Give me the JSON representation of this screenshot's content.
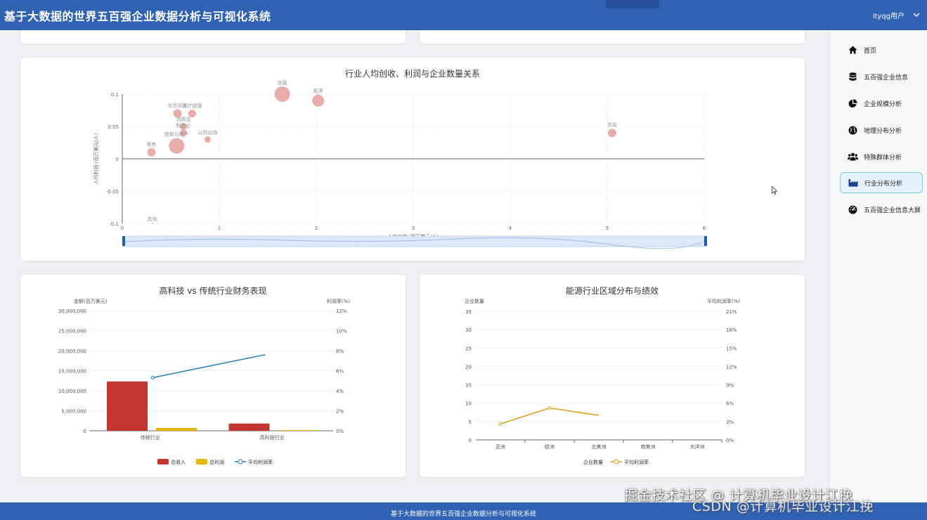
{
  "header": {
    "title": "基于大数据的世界五百强企业数据分析与可视化系统",
    "user": "ityqg用户"
  },
  "sidebar": {
    "items": [
      {
        "label": "首页",
        "icon": "home-icon"
      },
      {
        "label": "五百强企业信息",
        "icon": "database-icon"
      },
      {
        "label": "企业规模分析",
        "icon": "pie-chart-icon"
      },
      {
        "label": "地理分布分析",
        "icon": "globe-icon"
      },
      {
        "label": "特殊群体分析",
        "icon": "users-icon"
      },
      {
        "label": "行业分布分析",
        "icon": "industry-icon",
        "active": true
      },
      {
        "label": "五百强企业信息大屏",
        "icon": "dashboard-icon"
      }
    ]
  },
  "chart_data": [
    {
      "type": "scatter",
      "title": "行业人均创收、利润与企业数量关系",
      "xlabel": "人均创收 (百万美元/人)",
      "ylabel": "人均利润 (百万美元/人)",
      "xlim": [
        0,
        6
      ],
      "ylim": [
        -0.1,
        0.1
      ],
      "xticks": [
        "0",
        "1",
        "2",
        "3",
        "4",
        "5",
        "6"
      ],
      "yticks": [
        "0.1",
        "0.05",
        "0",
        "-0.05",
        "-0.1"
      ],
      "points": [
        {
          "label": "金融",
          "x": 1.65,
          "y": 0.1,
          "size": 11
        },
        {
          "label": "能源",
          "x": 2.02,
          "y": 0.09,
          "size": 8.5
        },
        {
          "label": "信息技术",
          "x": 0.57,
          "y": 0.07,
          "size": 6
        },
        {
          "label": "医疗健康",
          "x": 0.72,
          "y": 0.07,
          "size": 5.5
        },
        {
          "label": "消费品",
          "x": 0.63,
          "y": 0.05,
          "size": 5
        },
        {
          "label": "制造业",
          "x": 0.63,
          "y": 0.04,
          "size": 5
        },
        {
          "label": "公用设施",
          "x": 0.88,
          "y": 0.03,
          "size": 4.5
        },
        {
          "label": "建筑与地产",
          "x": 0.56,
          "y": 0.02,
          "size": 11
        },
        {
          "label": "零售",
          "x": 0.3,
          "y": 0.01,
          "size": 6
        },
        {
          "label": "贸易",
          "x": 5.05,
          "y": 0.04,
          "size": 6
        },
        {
          "label": "其他",
          "x": 0.31,
          "y": -0.1,
          "size": 1
        }
      ]
    },
    {
      "type": "bar",
      "title": "高科技 vs 传统行业财务表现",
      "categories": [
        "传统行业",
        "高科技行业"
      ],
      "y_left_label": "金额(百万美元)",
      "y_right_label": "利润率(%)",
      "ylim_left": [
        0,
        30000000
      ],
      "ylim_right": [
        0,
        12
      ],
      "left_ticks": [
        "0",
        "5,000,000",
        "10,000,000",
        "15,000,000",
        "20,000,000",
        "25,000,000",
        "30,000,000"
      ],
      "right_ticks": [
        "0%",
        "2%",
        "4%",
        "6%",
        "8%",
        "10%",
        "12%"
      ],
      "series": [
        {
          "name": "总收入",
          "type": "bar",
          "color": "#c23531",
          "values": [
            12300000,
            1800000
          ]
        },
        {
          "name": "总利润",
          "type": "bar",
          "color": "#e6b600",
          "values": [
            700000,
            150000
          ]
        },
        {
          "name": "平均利润率",
          "type": "line",
          "color": "#1f7fb6",
          "values": [
            5.3,
            7.6
          ]
        }
      ]
    },
    {
      "type": "line",
      "title": "能源行业区域分布与绩效",
      "categories": [
        "亚洲",
        "欧洲",
        "北美洲",
        "南美洲",
        "大洋洲"
      ],
      "y_left_label": "企业数量",
      "y_right_label": "平均利润率(%)",
      "ylim_left": [
        0,
        35
      ],
      "ylim_right": [
        0,
        21
      ],
      "left_ticks": [
        "0",
        "5",
        "10",
        "15",
        "20",
        "25",
        "30",
        "35"
      ],
      "right_ticks": [
        "0%",
        "3%",
        "6%",
        "9%",
        "12%",
        "15%",
        "18%",
        "21%"
      ],
      "series": [
        {
          "name": "企业数量",
          "type": "bar",
          "color": "#5470c6",
          "values": []
        },
        {
          "name": "平均利润率",
          "type": "line",
          "color": "#d4a017",
          "values": [
            2.6,
            5.2,
            4.0
          ]
        }
      ]
    }
  ],
  "footer": {
    "text": "基于大数据的世界五百强企业数据分析与可视化系统"
  },
  "watermark": {
    "line1": "掘金技术社区 @ 计算机毕业设计江挽",
    "line2": "CSDN @计算机毕业设计江挽"
  }
}
